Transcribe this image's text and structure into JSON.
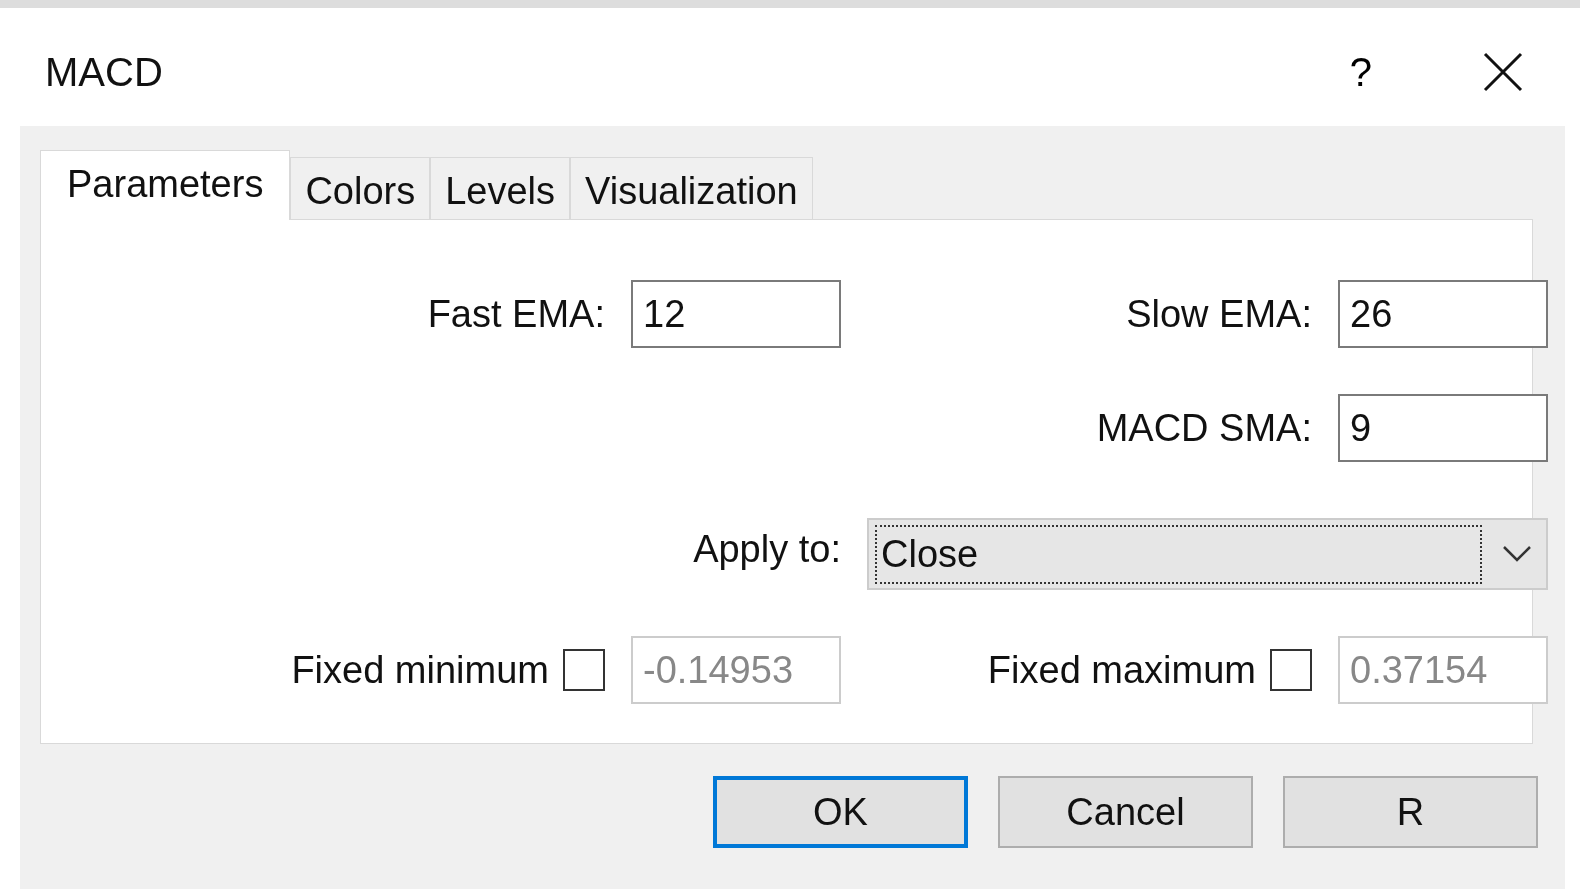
{
  "window": {
    "title": "MACD",
    "help": "?"
  },
  "tabs": [
    {
      "label": "Parameters",
      "selected": true
    },
    {
      "label": "Colors",
      "selected": false
    },
    {
      "label": "Levels",
      "selected": false
    },
    {
      "label": "Visualization",
      "selected": false
    }
  ],
  "fast_ema": {
    "label": "Fast EMA:",
    "value": "12"
  },
  "slow_ema": {
    "label": "Slow EMA:",
    "value": "26"
  },
  "macd_sma": {
    "label": "MACD SMA:",
    "value": "9"
  },
  "apply_to": {
    "label": "Apply to:",
    "value": "Close"
  },
  "fixed_minimum": {
    "label": "Fixed minimum",
    "checked": false,
    "value": "-0.14953",
    "disabled": true
  },
  "fixed_maximum": {
    "label": "Fixed maximum",
    "checked": false,
    "value": "0.37154",
    "disabled": true
  },
  "buttons": [
    {
      "label": "OK",
      "default": true
    },
    {
      "label": "Cancel",
      "default": false
    },
    {
      "label": "R",
      "default": false
    }
  ]
}
